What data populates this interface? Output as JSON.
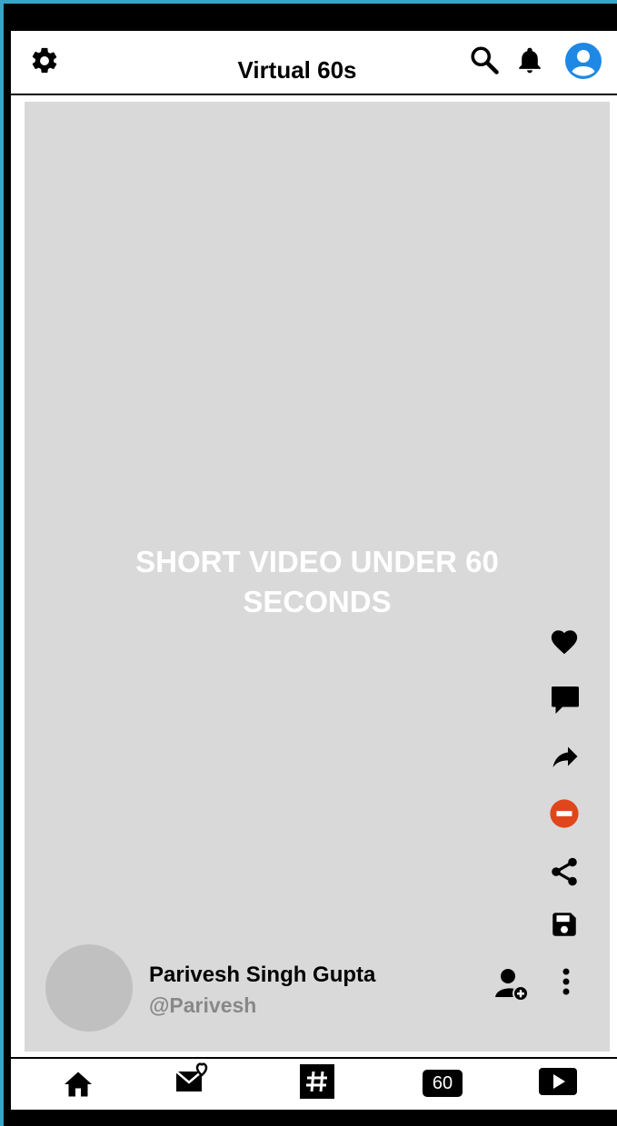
{
  "app": {
    "title": "Virtual 60s"
  },
  "topbar": {
    "icons": [
      "gear-icon",
      "search-icon",
      "bell-icon",
      "user-avatar-icon"
    ],
    "accent": "#1e88e5"
  },
  "video": {
    "placeholder_text": "SHORT VIDEO UNDER 60 SECONDS",
    "background": "#d9d9d9"
  },
  "actions": {
    "icons": [
      "heart-icon",
      "comment-icon",
      "forward-icon",
      "block-icon",
      "share-icon",
      "save-icon"
    ],
    "block_color": "#e0461c"
  },
  "creator": {
    "name": "Parivesh Singh Gupta",
    "handle": "@Parivesh",
    "icons": [
      "follow-user-icon",
      "more-vertical-icon"
    ]
  },
  "bottom_nav": {
    "items": [
      "home-icon",
      "inbox-heart-icon",
      "hashtag-icon",
      "sixty-badge",
      "play-icon"
    ],
    "sixty_label": "60"
  }
}
